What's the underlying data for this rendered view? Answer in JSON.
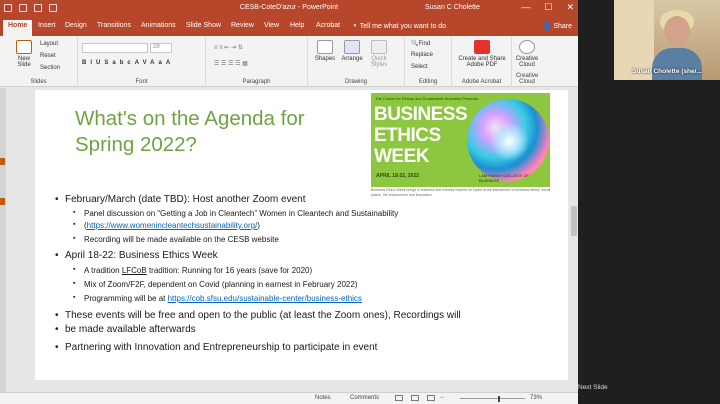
{
  "window": {
    "title": "CESB-CoteD'azur  -  PowerPoint",
    "user": "Susan C Cholette",
    "controls": [
      "—",
      "☐",
      "✕"
    ]
  },
  "tabs": [
    "Home",
    "Insert",
    "Design",
    "Transitions",
    "Animations",
    "Slide Show",
    "Review",
    "View",
    "Help",
    "Acrobat"
  ],
  "tell_me": "Tell me what you want to do",
  "share": "Share",
  "ribbon": {
    "slides_group": {
      "new_slide": "New Slide",
      "layout": "Layout",
      "reset": "Reset",
      "section": "Section",
      "label": "Slides"
    },
    "font_group": {
      "label": "Font",
      "size": "28",
      "buttons": [
        "B",
        "I",
        "U",
        "S",
        "abc",
        "AV",
        "Aa",
        "A"
      ]
    },
    "paragraph_group": {
      "label": "Paragraph"
    },
    "drawing_group": {
      "label": "Drawing",
      "shapes": "Shapes",
      "arrange": "Arrange",
      "quick_styles": "Quick Styles"
    },
    "editing_group": {
      "label": "Editing",
      "find": "Find",
      "replace": "Replace",
      "select": "Select"
    },
    "acrobat_group": {
      "label": "Adobe Acrobat",
      "create_share": "Create and Share Adobe PDF"
    },
    "cc_group": {
      "label": "Creative Cloud",
      "creative_cloud": "Creative Cloud"
    }
  },
  "slide": {
    "title": "What's on the Agenda for Spring 2022?",
    "image": {
      "presents": "The Center for Ethical and Sustainable Business Presents",
      "line1": "BUSINESS",
      "line2": "ETHICS",
      "line3": "WEEK",
      "dates": "APRIL 18-22, 2022",
      "logo": "LAM FAMILY COLLEGE OF BUSINESS"
    },
    "caption": "Business Ethics Week brings in business and industry experts on topics at the intersection of business ethics, social justice, the environment and innovation",
    "bullets": [
      {
        "text": "February/March (date TBD): Host another Zoom event",
        "subs": [
          {
            "text": "Panel discussion on “Getting a Job in Cleantech”  Women in Cleantech and Sustainability"
          },
          {
            "prefix": "(",
            "link": "https://www.womenincleantechsustainability.org/",
            "suffix": ")"
          },
          {
            "text": "Recording will be made available on the CESB website"
          }
        ]
      },
      {
        "text": "April 18-22:  Business Ethics Week",
        "subs": [
          {
            "prefix": "A tradition ",
            "underlined": "LFCoB",
            "suffix": " tradition: Running for 16 years (save for 2020)"
          },
          {
            "text": "Mix of Zoom/F2F,  dependent on Covid (planning in earnest in February 2022)"
          },
          {
            "prefix": "Programming will be at ",
            "link": "https://cob.sfsu.edu/sustainable-center/business-ethics"
          }
        ]
      },
      {
        "text": "These events will be free and open to the public (at least the Zoom ones), Recordings will",
        "cont": "be made available afterwards"
      },
      {
        "text": "Partnering with Innovation and Entrepreneurship to participate in event"
      }
    ]
  },
  "status": {
    "notes": "Notes",
    "comments": "Comments",
    "zoom": "73%"
  },
  "zoom_pane": {
    "participant": "Susan Cholette (she/...",
    "next_slide": "Next Slide"
  }
}
